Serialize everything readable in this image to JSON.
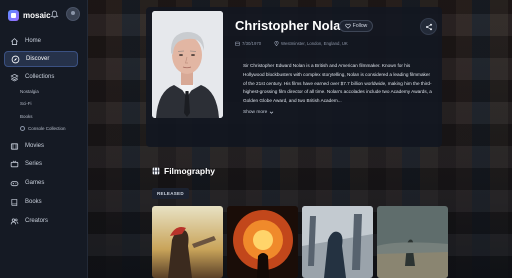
{
  "app": {
    "name": "mosaic"
  },
  "sidebar": {
    "items": [
      {
        "label": "Home",
        "icon": "home-icon"
      },
      {
        "label": "Discover",
        "icon": "compass-icon",
        "active": true
      },
      {
        "label": "Collections",
        "icon": "layers-icon"
      },
      {
        "label": "Movies",
        "icon": "film-icon"
      },
      {
        "label": "Series",
        "icon": "tv-icon"
      },
      {
        "label": "Games",
        "icon": "gamepad-icon"
      },
      {
        "label": "Books",
        "icon": "book-icon"
      },
      {
        "label": "Creators",
        "icon": "users-icon"
      }
    ],
    "collections": [
      "Nostalgia",
      "Sci-Fi",
      "Books",
      "Console Collection"
    ]
  },
  "person": {
    "name": "Christopher Nolan",
    "follow_label": "Follow",
    "birth_date": "7/30/1970",
    "birthplace": "Westminster, London, England, UK",
    "bio": "Sir Christopher Edward Nolan is a British and American filmmaker. Known for his Hollywood blockbusters with complex storytelling, Nolan is considered a leading filmmaker of the 21st century. His films have earned over $7.7 billion worldwide, making him the third-highest-grossing film director of all time. Nolan's accolades include two Academy Awards, a Golden Globe Award, and two British Academ...",
    "show_more_label": "Show more"
  },
  "filmography": {
    "title": "Filmography",
    "filter_label": "RELEASED"
  },
  "colors": {
    "accent": "#4f7cff",
    "active_nav_bg": "#26324a",
    "background": "#0f131b"
  }
}
